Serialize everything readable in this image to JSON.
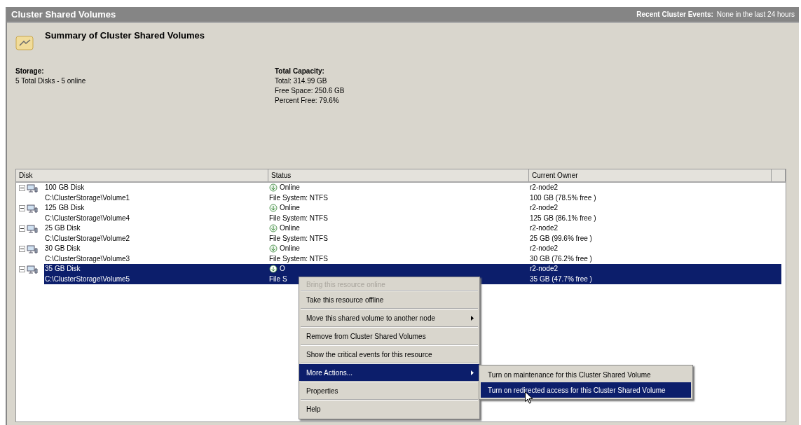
{
  "title_bar": {
    "title": "Cluster Shared Volumes",
    "events_label": "Recent Cluster Events:",
    "events_value": "None in the last 24 hours"
  },
  "summary": {
    "heading": "Summary of Cluster Shared Volumes",
    "storage_label": "Storage:",
    "storage_value": "5 Total Disks - 5 online",
    "capacity_label": "Total Capacity:",
    "capacity_lines": [
      "Total: 314.99 GB",
      "Free Space: 250.6 GB",
      "Percent Free: 79.6%"
    ]
  },
  "table": {
    "columns": [
      "Disk",
      "Status",
      "Current Owner"
    ],
    "rows": [
      {
        "disk": "100 GB Disk",
        "path": "C:\\ClusterStorage\\Volume1",
        "status": "Online",
        "file_system": "File System: NTFS",
        "owner": "r2-node2",
        "size": "100 GB (78.5% free )",
        "expanded": true,
        "selected": false
      },
      {
        "disk": "125 GB Disk",
        "path": "C:\\ClusterStorage\\Volume4",
        "status": "Online",
        "file_system": "File System: NTFS",
        "owner": "r2-node2",
        "size": "125 GB (86.1% free )",
        "expanded": true,
        "selected": false
      },
      {
        "disk": "25 GB Disk",
        "path": "C:\\ClusterStorage\\Volume2",
        "status": "Online",
        "file_system": "File System: NTFS",
        "owner": "r2-node2",
        "size": "25 GB (99.6% free )",
        "expanded": true,
        "selected": false
      },
      {
        "disk": "30 GB Disk",
        "path": "C:\\ClusterStorage\\Volume3",
        "status": "Online",
        "file_system": "File System: NTFS",
        "owner": "r2-node2",
        "size": "30 GB (76.2% free )",
        "expanded": true,
        "selected": false
      },
      {
        "disk": "35 GB Disk",
        "path": "C:\\ClusterStorage\\Volume5",
        "status": "O",
        "file_system": "File S",
        "owner": "r2-node2",
        "size": "35 GB (47.7% free )",
        "expanded": true,
        "selected": true
      }
    ]
  },
  "context_menu": {
    "items": [
      {
        "label": "Bring this resource online",
        "disabled": true,
        "selected": false,
        "submenu": false
      },
      {
        "label": "Take this resource offline",
        "disabled": false,
        "selected": false,
        "submenu": false
      },
      {
        "label": "Move this shared volume to another node",
        "disabled": false,
        "selected": false,
        "submenu": true
      },
      {
        "label": "Remove from Cluster Shared Volumes",
        "disabled": false,
        "selected": false,
        "submenu": false
      },
      {
        "label": "Show the critical events for this resource",
        "disabled": false,
        "selected": false,
        "submenu": false
      },
      {
        "label": "More Actions...",
        "disabled": false,
        "selected": true,
        "submenu": true
      },
      {
        "label": "Properties",
        "disabled": false,
        "selected": false,
        "submenu": false
      },
      {
        "label": "Help",
        "disabled": false,
        "selected": false,
        "submenu": false
      }
    ]
  },
  "submenu": {
    "items": [
      {
        "label": "Turn on maintenance for this Cluster Shared Volume",
        "selected": false
      },
      {
        "label": "Turn on redirected access for this Cluster Shared Volume",
        "selected": true
      }
    ]
  }
}
